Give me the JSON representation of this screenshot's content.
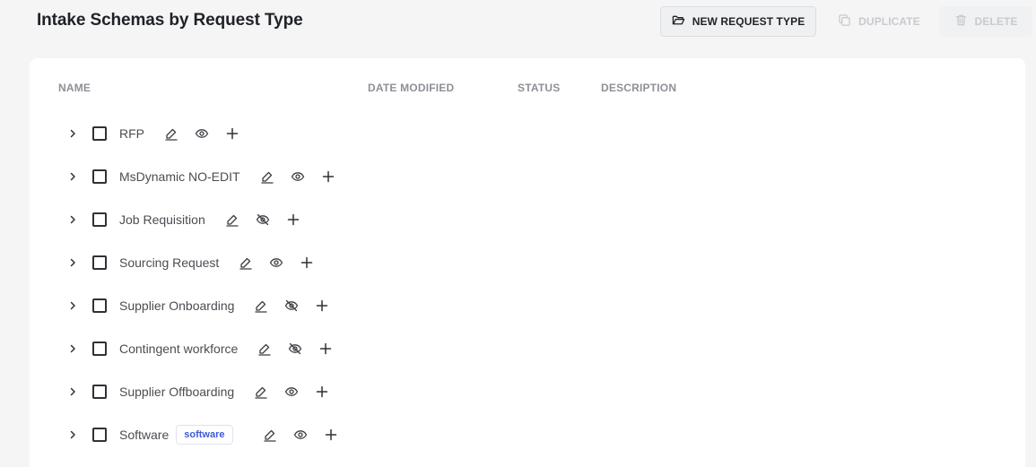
{
  "page": {
    "title": "Intake Schemas by Request Type"
  },
  "toolbar": {
    "new_label": "NEW REQUEST TYPE",
    "duplicate_label": "DUPLICATE",
    "delete_label": "DELETE"
  },
  "table": {
    "columns": [
      "NAME",
      "DATE MODIFIED",
      "STATUS",
      "DESCRIPTION"
    ],
    "rows": [
      {
        "name": "RFP",
        "tag": "",
        "visible": true
      },
      {
        "name": "MsDynamic NO-EDIT",
        "tag": "",
        "visible": true
      },
      {
        "name": "Job Requisition",
        "tag": "",
        "visible": false
      },
      {
        "name": "Sourcing Request",
        "tag": "",
        "visible": true
      },
      {
        "name": "Supplier Onboarding",
        "tag": "",
        "visible": false
      },
      {
        "name": "Contingent workforce",
        "tag": "",
        "visible": false
      },
      {
        "name": "Supplier Offboarding",
        "tag": "",
        "visible": true
      },
      {
        "name": "Software",
        "tag": "software",
        "visible": true
      }
    ]
  },
  "colors": {
    "background": "#f5f5f6",
    "card": "#ffffff",
    "tag_text": "#3b5bd6",
    "disabled_text": "#c8cace"
  },
  "icons": {
    "row_actions": [
      "edit-icon",
      "eye-icon",
      "plus-icon"
    ],
    "hidden_state": "eye-off-icon"
  }
}
